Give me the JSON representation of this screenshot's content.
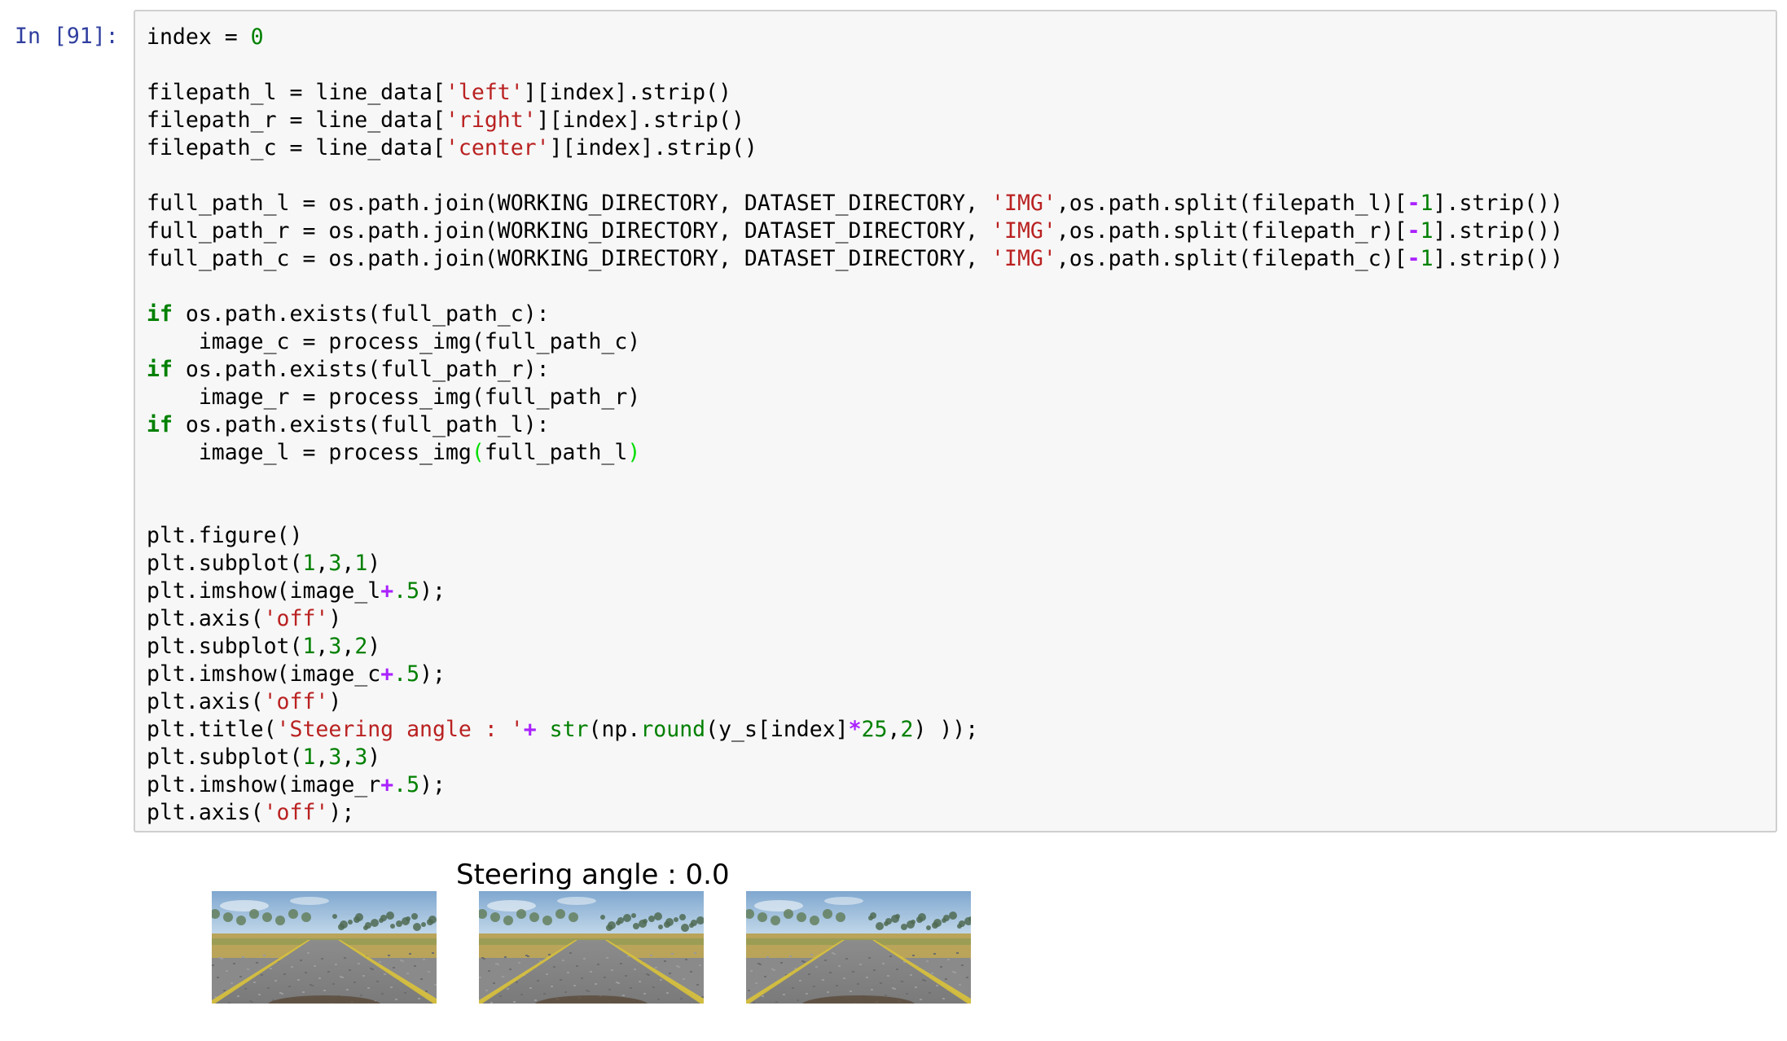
{
  "cell": {
    "prompt": "In [91]:",
    "code_lines": [
      [
        {
          "t": "index = ",
          "c": ""
        },
        {
          "t": "0",
          "c": "num"
        }
      ],
      [],
      [
        {
          "t": "filepath_l = line_data[",
          "c": ""
        },
        {
          "t": "'left'",
          "c": "str"
        },
        {
          "t": "][index].strip()",
          "c": ""
        }
      ],
      [
        {
          "t": "filepath_r = line_data[",
          "c": ""
        },
        {
          "t": "'right'",
          "c": "str"
        },
        {
          "t": "][index].strip()",
          "c": ""
        }
      ],
      [
        {
          "t": "filepath_c = line_data[",
          "c": ""
        },
        {
          "t": "'center'",
          "c": "str"
        },
        {
          "t": "][index].strip()",
          "c": ""
        }
      ],
      [],
      [
        {
          "t": "full_path_l = os.path.join(WORKING_DIRECTORY, DATASET_DIRECTORY, ",
          "c": ""
        },
        {
          "t": "'IMG'",
          "c": "str"
        },
        {
          "t": ",os.path.split(filepath_l)[",
          "c": ""
        },
        {
          "t": "-",
          "c": "op"
        },
        {
          "t": "1",
          "c": "num"
        },
        {
          "t": "].strip())",
          "c": ""
        }
      ],
      [
        {
          "t": "full_path_r = os.path.join(WORKING_DIRECTORY, DATASET_DIRECTORY, ",
          "c": ""
        },
        {
          "t": "'IMG'",
          "c": "str"
        },
        {
          "t": ",os.path.split(filepath_r)[",
          "c": ""
        },
        {
          "t": "-",
          "c": "op"
        },
        {
          "t": "1",
          "c": "num"
        },
        {
          "t": "].strip())",
          "c": ""
        }
      ],
      [
        {
          "t": "full_path_c = os.path.join(WORKING_DIRECTORY, DATASET_DIRECTORY, ",
          "c": ""
        },
        {
          "t": "'IMG'",
          "c": "str"
        },
        {
          "t": ",os.path.split(filepath_c)[",
          "c": ""
        },
        {
          "t": "-",
          "c": "op"
        },
        {
          "t": "1",
          "c": "num"
        },
        {
          "t": "].strip())",
          "c": ""
        }
      ],
      [],
      [
        {
          "t": "if",
          "c": "kw"
        },
        {
          "t": " os.path.exists(full_path_c):",
          "c": ""
        }
      ],
      [
        {
          "t": "    image_c = process_img(full_path_c)",
          "c": ""
        }
      ],
      [
        {
          "t": "if",
          "c": "kw"
        },
        {
          "t": " os.path.exists(full_path_r):",
          "c": ""
        }
      ],
      [
        {
          "t": "    image_r = process_img(full_path_r)",
          "c": ""
        }
      ],
      [
        {
          "t": "if",
          "c": "kw"
        },
        {
          "t": " os.path.exists(full_path_l):",
          "c": ""
        }
      ],
      [
        {
          "t": "    image_l = process_img",
          "c": ""
        },
        {
          "t": "(",
          "c": "match"
        },
        {
          "t": "full_path_l",
          "c": ""
        },
        {
          "t": ")",
          "c": "match"
        }
      ],
      [],
      [],
      [
        {
          "t": "plt.figure()",
          "c": ""
        }
      ],
      [
        {
          "t": "plt.subplot(",
          "c": ""
        },
        {
          "t": "1",
          "c": "num"
        },
        {
          "t": ",",
          "c": ""
        },
        {
          "t": "3",
          "c": "num"
        },
        {
          "t": ",",
          "c": ""
        },
        {
          "t": "1",
          "c": "num"
        },
        {
          "t": ")",
          "c": ""
        }
      ],
      [
        {
          "t": "plt.imshow(image_l",
          "c": ""
        },
        {
          "t": "+",
          "c": "op"
        },
        {
          "t": ".5",
          "c": "num"
        },
        {
          "t": ");",
          "c": ""
        }
      ],
      [
        {
          "t": "plt.axis(",
          "c": ""
        },
        {
          "t": "'off'",
          "c": "str"
        },
        {
          "t": ")",
          "c": ""
        }
      ],
      [
        {
          "t": "plt.subplot(",
          "c": ""
        },
        {
          "t": "1",
          "c": "num"
        },
        {
          "t": ",",
          "c": ""
        },
        {
          "t": "3",
          "c": "num"
        },
        {
          "t": ",",
          "c": ""
        },
        {
          "t": "2",
          "c": "num"
        },
        {
          "t": ")",
          "c": ""
        }
      ],
      [
        {
          "t": "plt.imshow(image_c",
          "c": ""
        },
        {
          "t": "+",
          "c": "op"
        },
        {
          "t": ".5",
          "c": "num"
        },
        {
          "t": ");",
          "c": ""
        }
      ],
      [
        {
          "t": "plt.axis(",
          "c": ""
        },
        {
          "t": "'off'",
          "c": "str"
        },
        {
          "t": ")",
          "c": ""
        }
      ],
      [
        {
          "t": "plt.title(",
          "c": ""
        },
        {
          "t": "'Steering angle : '",
          "c": "str"
        },
        {
          "t": "+",
          "c": "op"
        },
        {
          "t": " ",
          "c": ""
        },
        {
          "t": "str",
          "c": "builtin"
        },
        {
          "t": "(np.",
          "c": ""
        },
        {
          "t": "round",
          "c": "builtin"
        },
        {
          "t": "(y_s[index]",
          "c": ""
        },
        {
          "t": "*",
          "c": "op"
        },
        {
          "t": "25",
          "c": "num"
        },
        {
          "t": ",",
          "c": ""
        },
        {
          "t": "2",
          "c": "num"
        },
        {
          "t": ") ));",
          "c": ""
        }
      ],
      [
        {
          "t": "plt.subplot(",
          "c": ""
        },
        {
          "t": "1",
          "c": "num"
        },
        {
          "t": ",",
          "c": ""
        },
        {
          "t": "3",
          "c": "num"
        },
        {
          "t": ",",
          "c": ""
        },
        {
          "t": "3",
          "c": "num"
        },
        {
          "t": ")",
          "c": ""
        }
      ],
      [
        {
          "t": "plt.imshow(image_r",
          "c": ""
        },
        {
          "t": "+",
          "c": "op"
        },
        {
          "t": ".5",
          "c": "num"
        },
        {
          "t": ");",
          "c": ""
        }
      ],
      [
        {
          "t": "plt.axis(",
          "c": ""
        },
        {
          "t": "'off'",
          "c": "str"
        },
        {
          "t": ");",
          "c": ""
        }
      ]
    ]
  },
  "output": {
    "figure_title": "Steering angle : 0.0",
    "images": [
      {
        "name": "left-camera-image"
      },
      {
        "name": "center-camera-image"
      },
      {
        "name": "right-camera-image"
      }
    ]
  },
  "colors": {
    "prompt": "#303f9f",
    "keyword": "#008000",
    "string": "#ba2121",
    "number": "#008000",
    "operator": "#aa22ff",
    "code_background": "#f7f7f7",
    "code_border": "#cfcfcf"
  }
}
